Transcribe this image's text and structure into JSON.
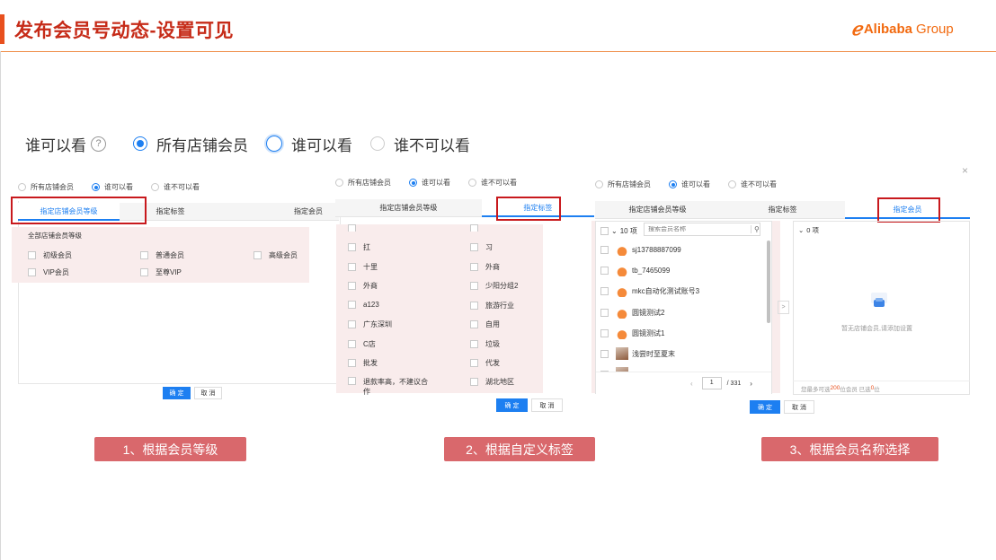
{
  "header": {
    "title": "发布会员号动态-设置可见",
    "logo_mark": "ℯ",
    "logo_brand": "Alibaba",
    "logo_group": "Group"
  },
  "visibility": {
    "label": "谁可以看",
    "help_icon": "?",
    "options": [
      "所有店铺会员",
      "谁可以看",
      "谁不可以看"
    ],
    "selected": "所有店铺会员",
    "focused": "谁可以看"
  },
  "panel1": {
    "radios": [
      "所有店铺会员",
      "谁可以看",
      "谁不可以看"
    ],
    "selected": "谁可以看",
    "tabs": [
      "指定店铺会员等级",
      "指定标签",
      "指定会员"
    ],
    "active_tab": "指定店铺会员等级",
    "group_title": "全部店铺会员等级",
    "levels": [
      "初级会员",
      "普通会员",
      "高级会员",
      "VIP会员",
      "至尊VIP"
    ],
    "confirm": "确 定",
    "cancel": "取 消"
  },
  "panel2": {
    "radios": [
      "所有店铺会员",
      "谁可以看",
      "谁不可以看"
    ],
    "selected": "谁可以看",
    "tabs": [
      "指定店铺会员等级",
      "指定标签"
    ],
    "active_tab": "指定标签",
    "tags_left": [
      "扛",
      "十里",
      "外商",
      "a123",
      "广东深圳",
      "C店",
      "批发",
      "退款率高，不建议合作"
    ],
    "tags_right": [
      "习",
      "外商",
      "少阳分组2",
      "旅游行业",
      "自用",
      "垃圾",
      "代发",
      "湖北地区"
    ],
    "confirm": "确 定",
    "cancel": "取 消"
  },
  "panel3": {
    "radios": [
      "所有店铺会员",
      "谁可以看",
      "谁不可以看"
    ],
    "selected": "谁可以看",
    "tabs": [
      "指定店铺会员等级",
      "指定标签",
      "指定会员"
    ],
    "active_tab": "指定会员",
    "left_count": "10 项",
    "search_placeholder": "搜索会员名称",
    "members": [
      {
        "name": "sj13788887099",
        "avatar": "cat"
      },
      {
        "name": "tb_7465099",
        "avatar": "cat"
      },
      {
        "name": "mkc自动化测试账号3",
        "avatar": "cat"
      },
      {
        "name": "圆镜测试2",
        "avatar": "cat"
      },
      {
        "name": "圆镜测试1",
        "avatar": "cat"
      },
      {
        "name": "浅尝时至夏末",
        "avatar": "photo"
      }
    ],
    "page_current": "1",
    "page_total": "/ 331",
    "right_count": "0 项",
    "empty_text": "暂无店铺会员,请添加设置",
    "footer_prefix": "您最多可选",
    "footer_max": "200",
    "footer_mid": "位会员 已选",
    "footer_selected": "0",
    "footer_suffix": "位",
    "confirm": "确 定",
    "cancel": "取 消",
    "close_icon": "×",
    "transfer_arrow": ">"
  },
  "captions": [
    "1、根据会员等级",
    "2、根据自定义标签",
    "3、根据会员名称选择"
  ],
  "colors": {
    "accent": "#e8501e",
    "title": "#c62b18",
    "primary": "#1d7ff1",
    "highlight_box": "#c8191d",
    "caption_bg": "#d9686c"
  }
}
